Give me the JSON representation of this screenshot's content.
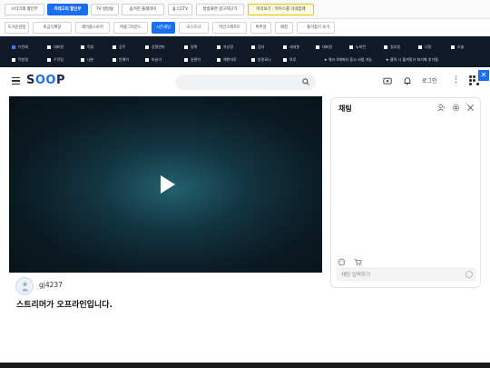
{
  "topbar": {
    "buttons": [
      {
        "label": "스타크래 할인부"
      },
      {
        "label": "카테고리 할인부"
      },
      {
        "label": "TV 방탄숍"
      },
      {
        "label": "숨겨진 플레이어"
      },
      {
        "label": "숲 CCTV"
      },
      {
        "label": "방송화면 광고차단기"
      },
      {
        "label": "미리보기 : 마우스를 낙네임에"
      }
    ]
  },
  "categories": [
    {
      "label": "뜨거운감정"
    },
    {
      "label": "비공식확장"
    },
    {
      "label": "레이블스토어"
    },
    {
      "label": "버블그라운드"
    },
    {
      "label": "시즌세팅"
    },
    {
      "label": "모스트나"
    },
    {
      "label": "마인크래프트"
    },
    {
      "label": "버추얼"
    },
    {
      "label": "애청"
    },
    {
      "label": "즐겨찾기 보기"
    }
  ],
  "streamer_grid": {
    "row1": [
      {
        "label": "뜨린메"
      },
      {
        "label": "대표왕"
      },
      {
        "label": "먹방"
      },
      {
        "label": "공주"
      },
      {
        "label": "강철연마"
      },
      {
        "label": "일찍"
      },
      {
        "label": "자상함"
      },
      {
        "label": "검지"
      },
      {
        "label": "세세봇"
      },
      {
        "label": "대표왕"
      },
      {
        "label": "뉴비런"
      },
      {
        "label": "일부왕"
      },
      {
        "label": "너랑"
      },
      {
        "label": "오솔"
      }
    ],
    "row2": [
      {
        "label": "먹방왕"
      },
      {
        "label": "수전탑"
      },
      {
        "label": "내손"
      },
      {
        "label": "반예이"
      },
      {
        "label": "마술이"
      },
      {
        "label": "송편이"
      },
      {
        "label": "해변하루"
      },
      {
        "label": "방종묘니"
      },
      {
        "label": "하루"
      }
    ],
    "notes": [
      "★ 체크 4개까지 동시 시청 가능",
      "★ 클릭 시 즐겨찾기 보기에 추가됨"
    ]
  },
  "header": {
    "logo": "SOOP",
    "login_label": "로그인"
  },
  "player": {
    "state": "paused"
  },
  "channel": {
    "username": "gj4237",
    "offline_message": "스트리머가 오프라인입니다."
  },
  "chat": {
    "title": "채팅",
    "input_placeholder": "채팅 입력하기"
  },
  "colors": {
    "accent": "#1a6ff0",
    "grid_bg": "#121a29"
  }
}
